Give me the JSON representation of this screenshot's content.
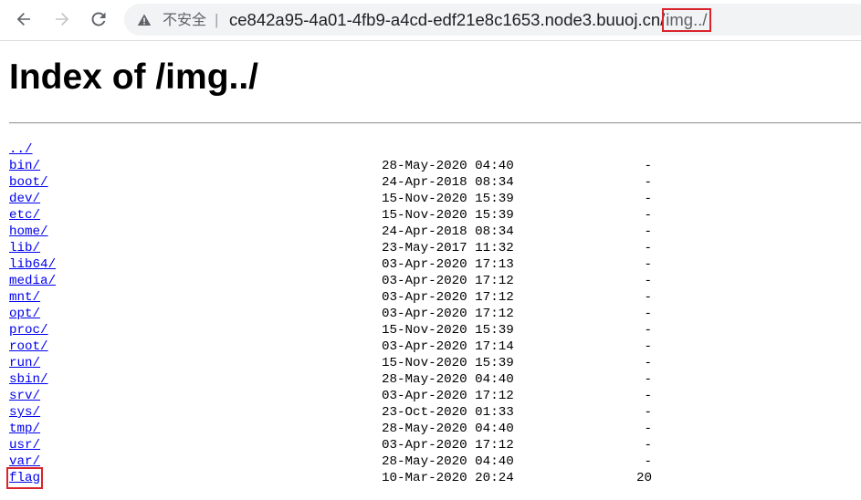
{
  "browser": {
    "security_label": "不安全",
    "separator": "|",
    "url_host": "ce842a95-4a01-4fb9-a4cd-edf21e8c1653.node3.buuoj.cn/",
    "url_path": "img../",
    "icons": {
      "back": "back-arrow-icon",
      "forward": "forward-arrow-icon",
      "reload": "reload-icon",
      "warning": "warning-triangle-icon"
    }
  },
  "page": {
    "title": "Index of /img../"
  },
  "listing": {
    "parent": "../",
    "entries": [
      {
        "name": "bin/",
        "date": "28-May-2020 04:40",
        "size": "-"
      },
      {
        "name": "boot/",
        "date": "24-Apr-2018 08:34",
        "size": "-"
      },
      {
        "name": "dev/",
        "date": "15-Nov-2020 15:39",
        "size": "-"
      },
      {
        "name": "etc/",
        "date": "15-Nov-2020 15:39",
        "size": "-"
      },
      {
        "name": "home/",
        "date": "24-Apr-2018 08:34",
        "size": "-"
      },
      {
        "name": "lib/",
        "date": "23-May-2017 11:32",
        "size": "-"
      },
      {
        "name": "lib64/",
        "date": "03-Apr-2020 17:13",
        "size": "-"
      },
      {
        "name": "media/",
        "date": "03-Apr-2020 17:12",
        "size": "-"
      },
      {
        "name": "mnt/",
        "date": "03-Apr-2020 17:12",
        "size": "-"
      },
      {
        "name": "opt/",
        "date": "03-Apr-2020 17:12",
        "size": "-"
      },
      {
        "name": "proc/",
        "date": "15-Nov-2020 15:39",
        "size": "-"
      },
      {
        "name": "root/",
        "date": "03-Apr-2020 17:14",
        "size": "-"
      },
      {
        "name": "run/",
        "date": "15-Nov-2020 15:39",
        "size": "-"
      },
      {
        "name": "sbin/",
        "date": "28-May-2020 04:40",
        "size": "-"
      },
      {
        "name": "srv/",
        "date": "03-Apr-2020 17:12",
        "size": "-"
      },
      {
        "name": "sys/",
        "date": "23-Oct-2020 01:33",
        "size": "-"
      },
      {
        "name": "tmp/",
        "date": "28-May-2020 04:40",
        "size": "-"
      },
      {
        "name": "usr/",
        "date": "03-Apr-2020 17:12",
        "size": "-"
      },
      {
        "name": "var/",
        "date": "28-May-2020 04:40",
        "size": "-"
      },
      {
        "name": "flag",
        "date": "10-Mar-2020 20:24",
        "size": "20"
      }
    ]
  },
  "colors": {
    "link": "#0000ee",
    "highlight_box": "#d9242b",
    "omnibox_bg": "#f1f3f4"
  }
}
